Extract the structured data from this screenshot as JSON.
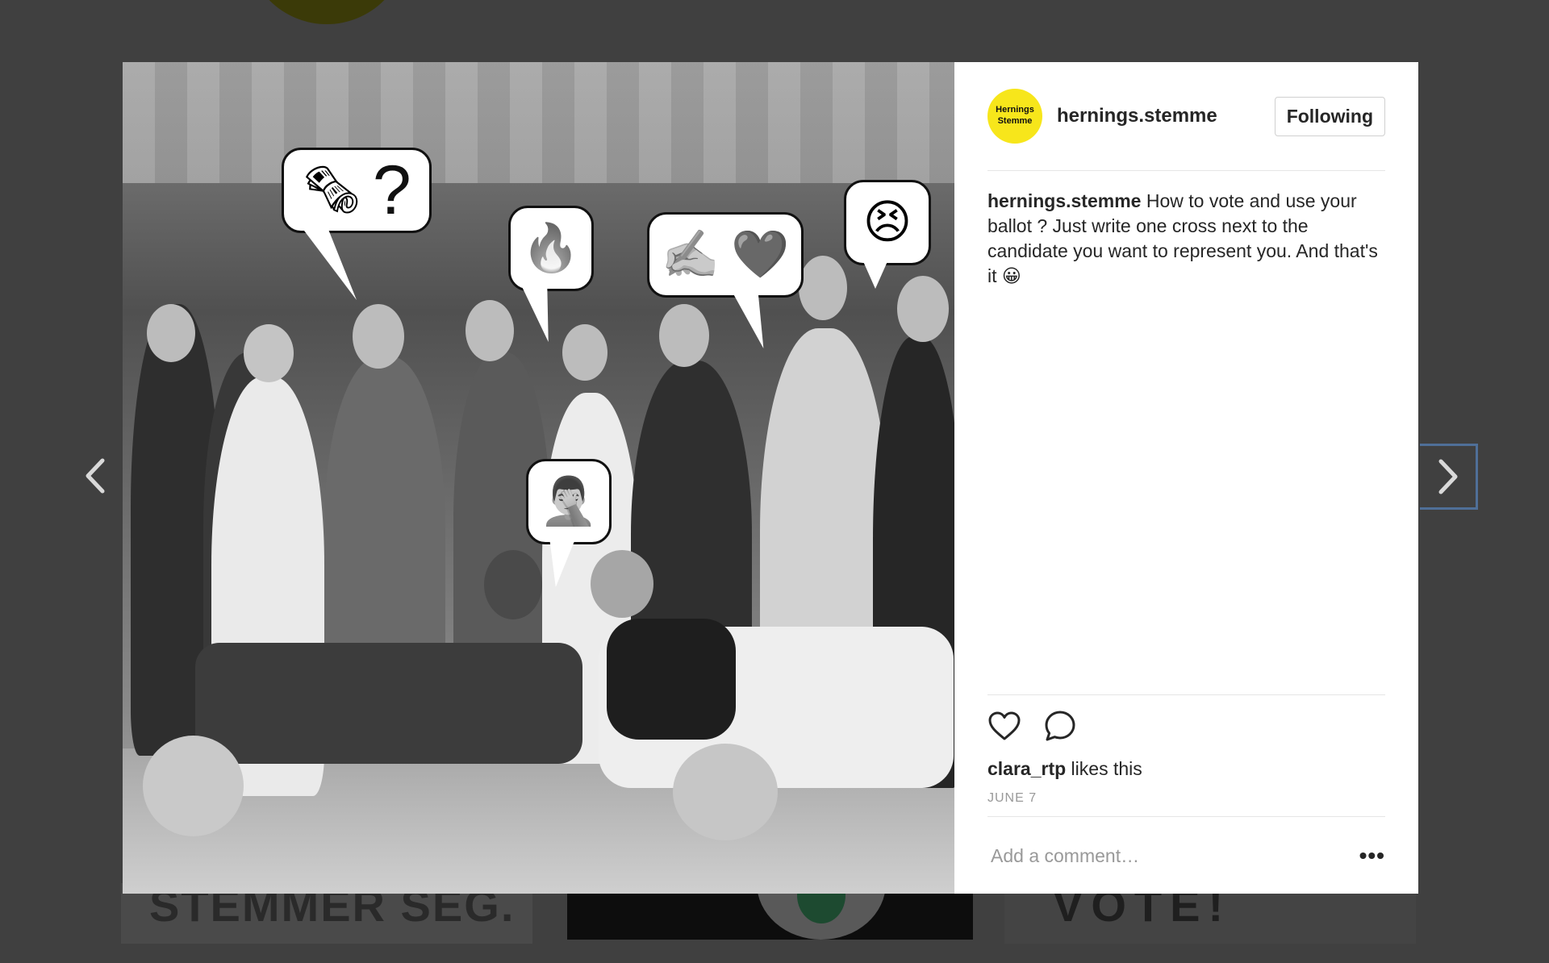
{
  "post": {
    "username": "hernings.stemme",
    "avatar_text_line1": "Hernings",
    "avatar_text_line2": "Stemme",
    "follow_label": "Following",
    "caption_user": "hernings.stemme",
    "caption_text": " How to vote and use your ballot ? Just write one cross next to the candidate you want to represent you. And that's it 😀",
    "liked_by_user": "clara_rtp",
    "liked_suffix": " likes this",
    "date": "JUNE 7",
    "comment_placeholder": "Add a comment…",
    "more_label": "•••"
  },
  "photo_bubbles": {
    "b1_icon": "🗞",
    "b1_text": "?",
    "b2_icon": "🔥",
    "b3_icon1": "✍️",
    "b3_icon2": "❤️",
    "b4_icon": "😣",
    "b5_icon": "🤦‍♂️"
  },
  "icons": {
    "prev": "chevron-left-icon",
    "next": "chevron-right-icon",
    "like": "heart-icon",
    "comment": "comment-icon"
  },
  "background_page": {
    "left_card_text": "STEMMER SEG.",
    "right_card_text": "VOTE!"
  },
  "colors": {
    "overlay": "#404040",
    "avatar": "#f7e61b",
    "next_focus": "#4f6f98"
  }
}
